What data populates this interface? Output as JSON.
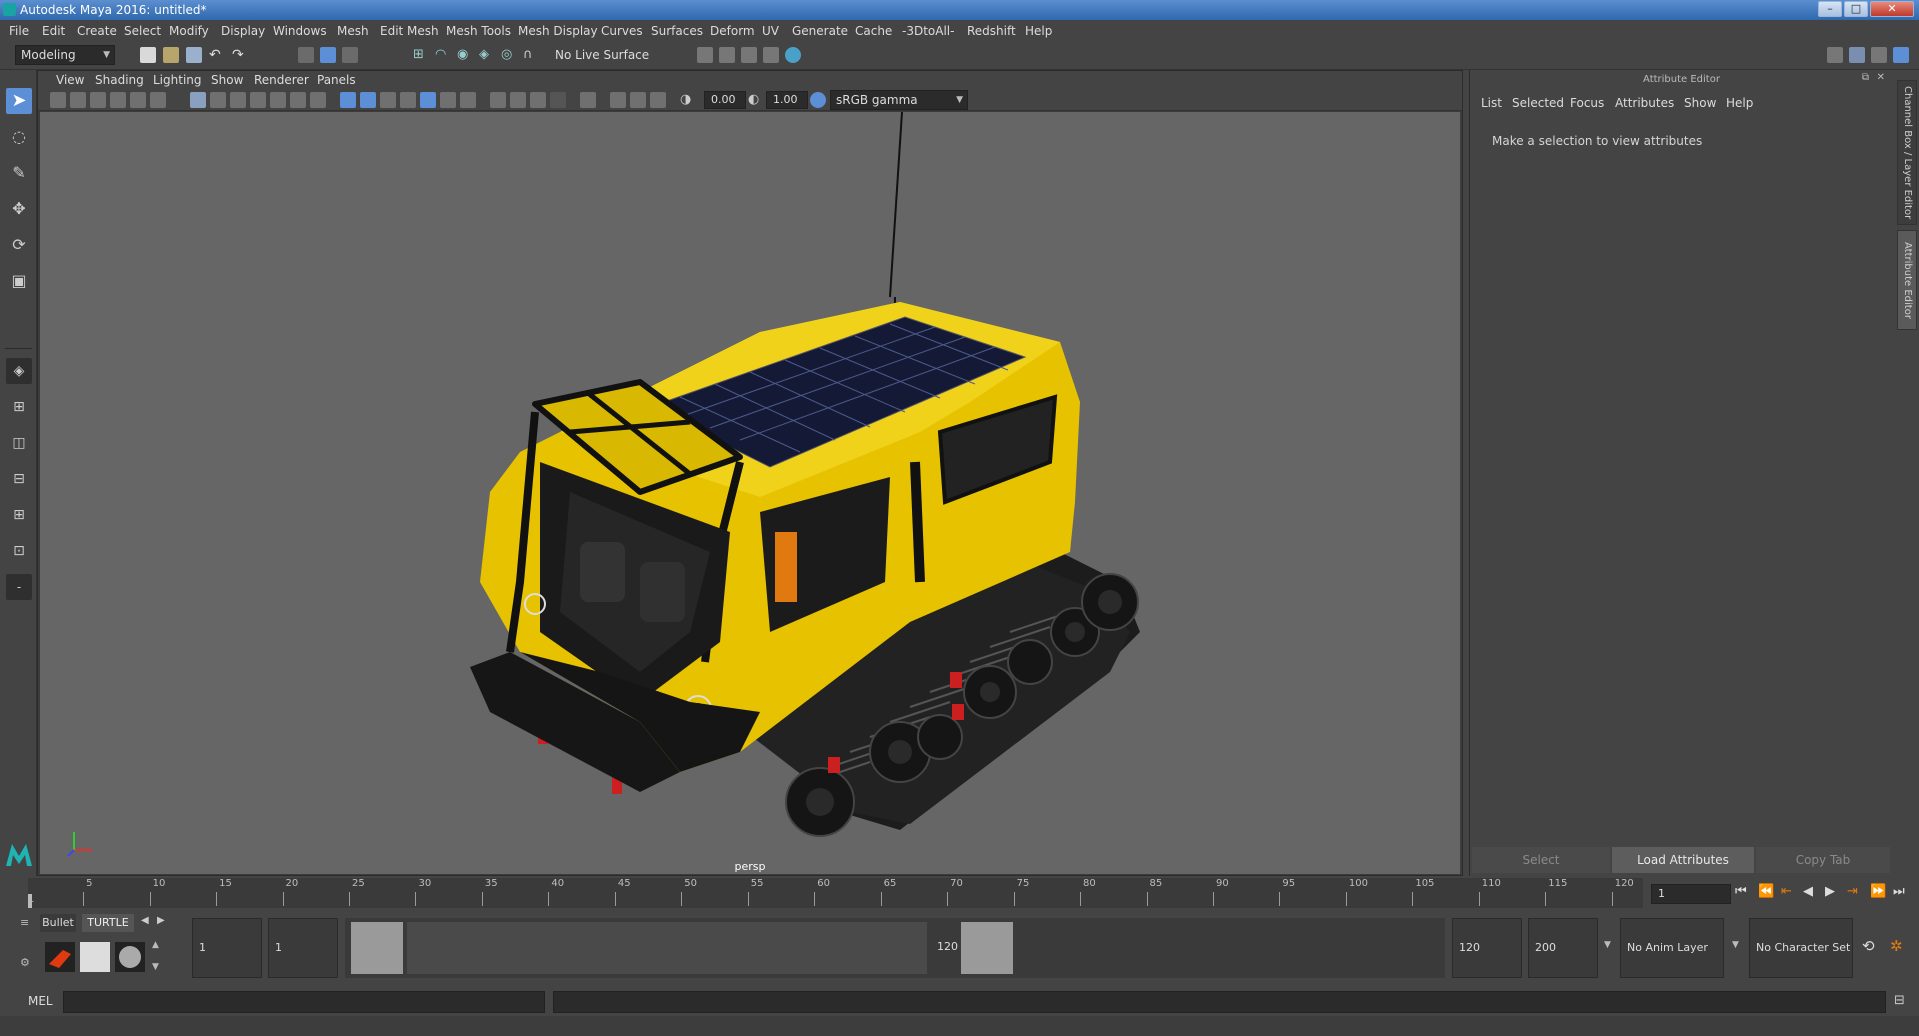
{
  "window": {
    "title": "Autodesk Maya 2016: untitled*",
    "min_label": "–",
    "max_label": "□",
    "close_label": "✕"
  },
  "menubar": {
    "items": [
      "File",
      "Edit",
      "Create",
      "Select",
      "Modify",
      "Display",
      "Windows",
      "Mesh",
      "Edit Mesh",
      "Mesh Tools",
      "Mesh Display",
      "Curves",
      "Surfaces",
      "Deform",
      "UV",
      "Generate",
      "Cache",
      "-3DtoAll-",
      "Redshift",
      "Help"
    ]
  },
  "statusline": {
    "mode": "Modeling",
    "live_surface": "No Live Surface"
  },
  "viewport": {
    "menus": [
      "View",
      "Shading",
      "Lighting",
      "Show",
      "Renderer",
      "Panels"
    ],
    "exposure": "0.00",
    "gamma": "1.00",
    "color_space": "sRGB gamma",
    "camera_label": "persp"
  },
  "attribute_editor": {
    "header": "Attribute Editor",
    "menus": [
      "List",
      "Selected",
      "Focus",
      "Attributes",
      "Show",
      "Help"
    ],
    "message": "Make a selection to view attributes",
    "buttons": {
      "select": "Select",
      "load": "Load Attributes",
      "copy": "Copy Tab"
    }
  },
  "side_tabs": {
    "channel_box": "Channel Box / Layer Editor",
    "attribute_editor": "Attribute Editor"
  },
  "timeline": {
    "ticks": [
      5,
      10,
      15,
      20,
      25,
      30,
      35,
      40,
      45,
      50,
      55,
      60,
      65,
      70,
      75,
      80,
      85,
      90,
      95,
      100,
      105,
      110,
      115,
      120
    ],
    "start_label": "1",
    "current_frame": "1"
  },
  "range": {
    "shelf_tabs": [
      "Bullet",
      "TURTLE"
    ],
    "start_field": "1",
    "playback_start": "1",
    "range_start_label": "1",
    "range_end_label": "120",
    "playback_end": "120",
    "end_field": "200",
    "anim_layer": "No Anim Layer",
    "character_set": "No Character Set"
  },
  "cmdline": {
    "language": "MEL"
  },
  "colors": {
    "accent": "#5c8fd6",
    "viewport_bg": "#666666",
    "vehicle_yellow": "#e6c200"
  }
}
